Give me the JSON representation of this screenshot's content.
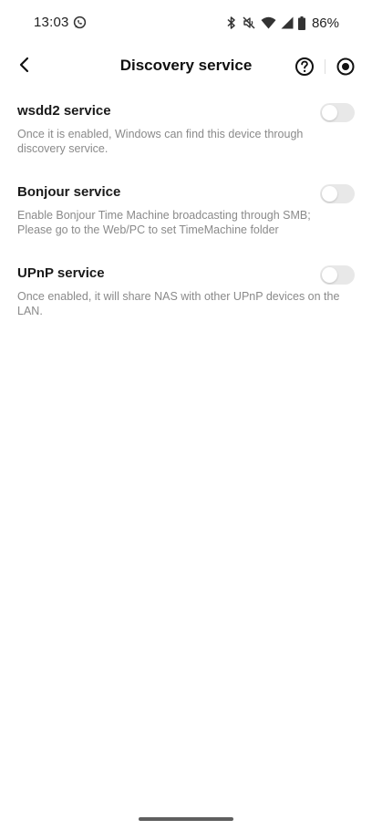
{
  "status_bar": {
    "time": "13:03",
    "battery": "86%",
    "icons": [
      "whatsapp-icon",
      "bluetooth-icon",
      "mute-icon",
      "wifi-icon",
      "cell-signal-icon",
      "battery-icon"
    ]
  },
  "header": {
    "title": "Discovery service",
    "back_icon": "back-arrow-icon",
    "help_icon": "help-circle-icon",
    "record_icon": "record-icon"
  },
  "settings": [
    {
      "title": "wsdd2 service",
      "description": "Once it is enabled, Windows can find this device through discovery service.",
      "enabled": false
    },
    {
      "title": "Bonjour service",
      "description_lines": [
        "Enable Bonjour Time Machine broadcasting through SMB;",
        "Please go to the Web/PC to set TimeMachine folder"
      ],
      "enabled": false
    },
    {
      "title": "UPnP service",
      "description": "Once enabled, it will share NAS with other UPnP devices on the LAN.",
      "enabled": false
    }
  ],
  "colors": {
    "toggle_off_track": "#e8e8e8",
    "description_text": "#8a8a8a",
    "title_text": "#1a1a1a"
  }
}
